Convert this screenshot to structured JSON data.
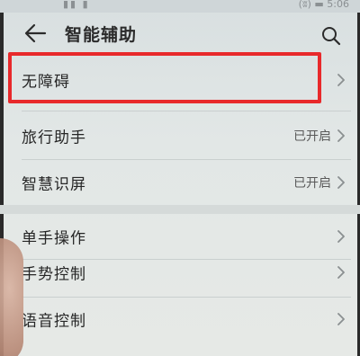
{
  "status_bar": {
    "left_text": "▮▮ ▮",
    "right_text": "(ʬ) ▬ 5:06"
  },
  "header": {
    "back_icon": "back-arrow-icon",
    "title": "智能辅助",
    "search_icon": "search-icon"
  },
  "items": [
    {
      "label": "无障碍",
      "value": "",
      "highlighted": true
    },
    {
      "label": "旅行助手",
      "value": "已开启"
    },
    {
      "label": "智慧识屏",
      "value": "已开启"
    },
    {
      "label": "单手操作",
      "value": ""
    },
    {
      "label": "手势控制",
      "value": ""
    },
    {
      "label": "语音控制",
      "value": ""
    }
  ],
  "colors": {
    "highlight_border": "#e8292b",
    "background": "#e2e7e6"
  }
}
